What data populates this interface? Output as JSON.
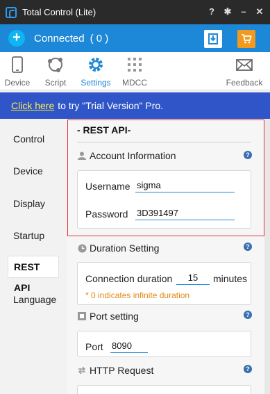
{
  "window": {
    "title": "Total Control (Lite)"
  },
  "connection": {
    "status": "Connected",
    "count": "( 0 )"
  },
  "toolbar": {
    "device": "Device",
    "script": "Script",
    "settings": "Settings",
    "mdcc": "MDCC",
    "feedback": "Feedback"
  },
  "trial": {
    "link": "Click here",
    "text": "to try \"Trial Version\" Pro."
  },
  "sidebar": {
    "items": [
      "Control",
      "Device",
      "Display",
      "Startup",
      "REST API",
      "Language"
    ],
    "active": "REST API"
  },
  "rest_api": {
    "title": "- REST API-",
    "account": {
      "heading": "Account Information",
      "username_label": "Username",
      "username_value": "sigma",
      "password_label": "Password",
      "password_value": "3D391497"
    },
    "duration": {
      "heading": "Duration Setting",
      "label": "Connection duration",
      "value": "15",
      "unit": "minutes",
      "note": "* 0 indicates infinite duration"
    },
    "port": {
      "heading": "Port setting",
      "label": "Port",
      "value": "8090"
    },
    "http": {
      "heading": "HTTP Request"
    }
  },
  "colors": {
    "accent": "#1e88d8",
    "trial_bar": "#2f55c9",
    "highlight": "#dd3333",
    "note": "#e08a16"
  }
}
